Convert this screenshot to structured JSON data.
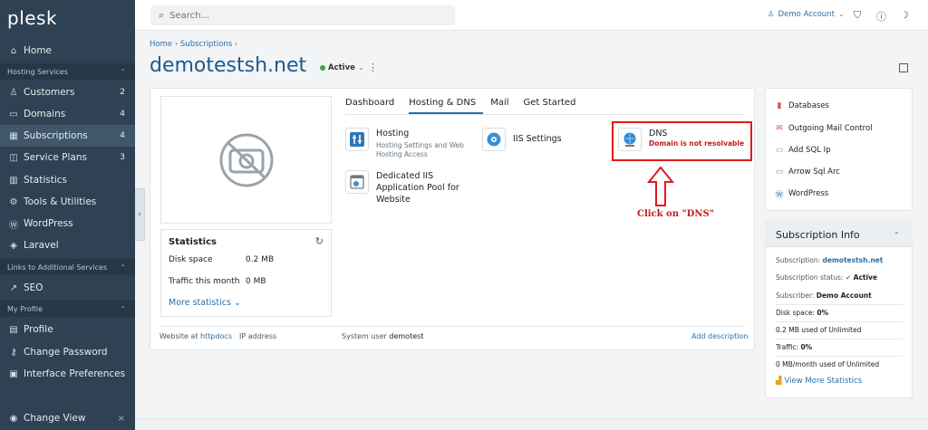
{
  "logo": "plesk",
  "sidebar": {
    "items": [
      {
        "label": "Home",
        "icon": "home-icon",
        "count": ""
      },
      {
        "label": "Customers",
        "icon": "user-icon",
        "count": "2"
      },
      {
        "label": "Domains",
        "icon": "monitor-icon",
        "count": "4"
      },
      {
        "label": "Subscriptions",
        "icon": "grid-icon",
        "count": "4"
      },
      {
        "label": "Service Plans",
        "icon": "book-icon",
        "count": "3"
      },
      {
        "label": "Statistics",
        "icon": "chart-icon",
        "count": ""
      },
      {
        "label": "Tools & Utilities",
        "icon": "tools-icon",
        "count": ""
      },
      {
        "label": "WordPress",
        "icon": "wordpress-icon",
        "count": ""
      },
      {
        "label": "Laravel",
        "icon": "laravel-icon",
        "count": ""
      },
      {
        "label": "SEO",
        "icon": "seo-icon",
        "count": ""
      },
      {
        "label": "Profile",
        "icon": "profile-icon",
        "count": ""
      },
      {
        "label": "Change Password",
        "icon": "key-icon",
        "count": ""
      },
      {
        "label": "Interface Preferences",
        "icon": "prefs-icon",
        "count": ""
      },
      {
        "label": "Change View",
        "icon": "eye-icon",
        "count": ""
      }
    ],
    "sections": {
      "hosting": "Hosting Services",
      "links": "Links to Additional Services",
      "profile": "My Profile"
    }
  },
  "topbar": {
    "search_placeholder": "Search...",
    "account": "Demo Account"
  },
  "breadcrumb": {
    "home": "Home",
    "sep": "›",
    "subs": "Subscriptions"
  },
  "domain": {
    "name": "demotestsh.net",
    "status": "Active"
  },
  "statistics": {
    "title": "Statistics",
    "disk_label": "Disk space",
    "disk_value": "0.2 MB",
    "traffic_label": "Traffic this month",
    "traffic_value": "0 MB",
    "more": "More statistics"
  },
  "tabs": [
    "Dashboard",
    "Hosting & DNS",
    "Mail",
    "Get Started"
  ],
  "tools": {
    "hosting_title": "Hosting",
    "hosting_sub": "Hosting Settings and Web Hosting Access",
    "iis": "IIS Settings",
    "dns_title": "DNS",
    "dns_warning": "Domain is not resolvable",
    "pool": "Dedicated IIS Application Pool for Website"
  },
  "annotation": "Click on \"DNS\"",
  "footer": {
    "website_at": "Website at",
    "httpdocs": "httpdocs",
    "ip": "IP address",
    "sysuser_label": "System user",
    "sysuser": "demotest",
    "add_desc": "Add description"
  },
  "right": {
    "links": [
      "Databases",
      "Outgoing Mail Control",
      "Add SQL Ip",
      "Arrow Sql Arc",
      "WordPress"
    ]
  },
  "subscription": {
    "title": "Subscription Info",
    "sub_label": "Subscription:",
    "sub_value": "demotestsh.net",
    "status_label": "Subscription status:",
    "status_value": "Active",
    "subscriber_label": "Subscriber:",
    "subscriber_value": "Demo Account",
    "disk_label": "Disk space:",
    "disk_value": "0%",
    "disk_used": "0.2 MB used of Unlimited",
    "traffic_label": "Traffic:",
    "traffic_value": "0%",
    "traffic_used": "0 MB/month used of Unlimited",
    "more": "View More Statistics"
  },
  "colors": {
    "sidebar": "#2f4253",
    "accent": "#2b6fa6",
    "title": "#1e5a8e",
    "alert": "#e0191b",
    "active": "#3fa34d"
  }
}
